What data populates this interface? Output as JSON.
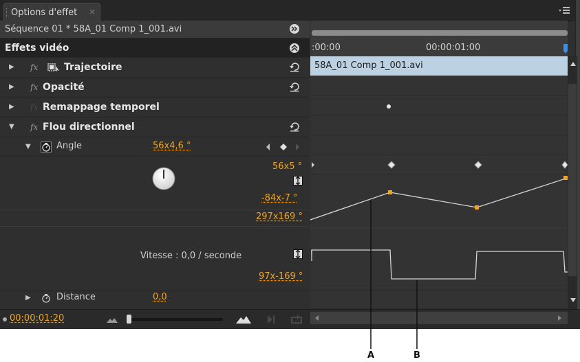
{
  "tab": {
    "title": "Options d'effet",
    "close": "×"
  },
  "sequence": {
    "name": "Séquence 01 * 58A_01 Comp 1_001.avi"
  },
  "timeline": {
    "start": ":00:00",
    "mid": "00:00:01:00",
    "clip_name": "58A_01 Comp 1_001.avi"
  },
  "section": {
    "title": "Effets vidéo"
  },
  "effects": {
    "trajectory": "Trajectoire",
    "opacity": "Opacité",
    "time_remap": "Remappage temporel",
    "directional_blur": "Flou directionnel"
  },
  "angle": {
    "label": "Angle",
    "value": "56x4,6 °",
    "max_value": "56x5 °",
    "min_value": "-84x-7 °",
    "speed_max": "297x169 °",
    "speed_min": "97x-169 °",
    "speed_text": "Vitesse : 0,0 / seconde"
  },
  "distance": {
    "label": "Distance",
    "value": "0,0"
  },
  "current_time": "00:00:01:20",
  "callouts": {
    "a": "A",
    "b": "B"
  },
  "colors": {
    "orange": "#f0a623",
    "clip": "#bcd2e2",
    "panel": "#2f2f2f"
  }
}
